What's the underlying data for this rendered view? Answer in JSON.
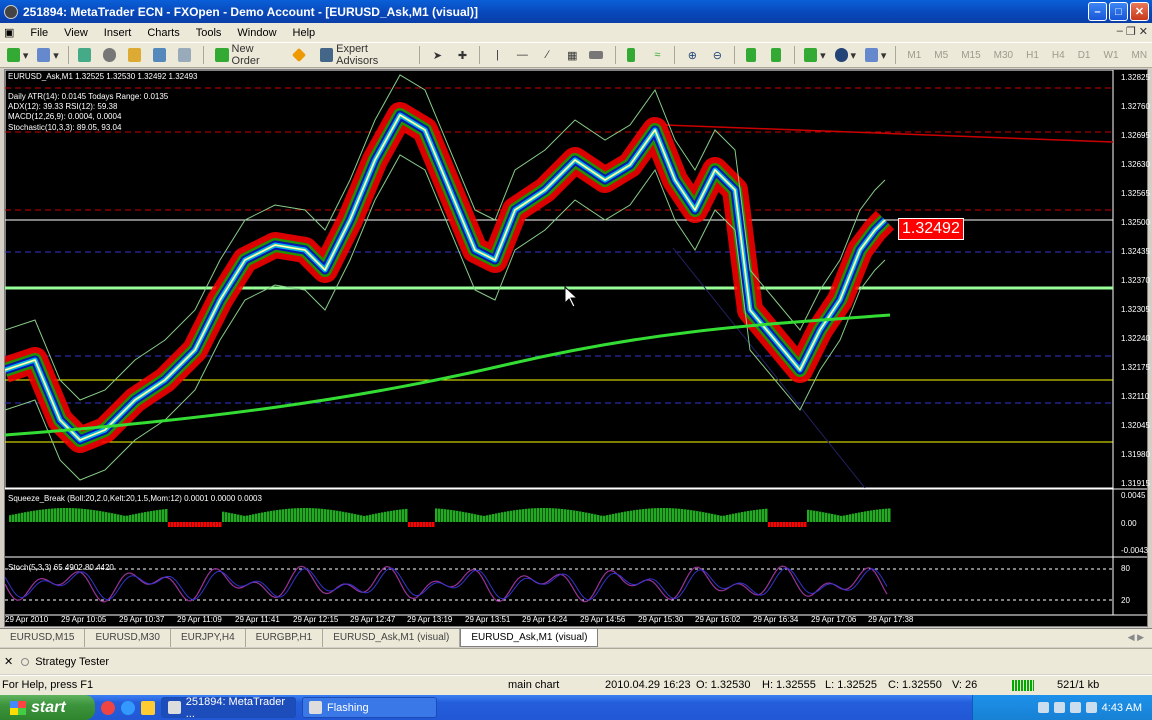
{
  "window": {
    "title": "251894: MetaTrader ECN - FXOpen - Demo Account - [EURUSD_Ask,M1 (visual)]"
  },
  "menu": [
    "File",
    "View",
    "Insert",
    "Charts",
    "Tools",
    "Window",
    "Help"
  ],
  "toolbar": {
    "new_order": "New Order",
    "expert_advisors": "Expert Advisors",
    "timeframes": [
      "M1",
      "M5",
      "M15",
      "M30",
      "H1",
      "H4",
      "D1",
      "W1",
      "MN"
    ]
  },
  "chart": {
    "header": "EURUSD_Ask,M1  1.32525 1.32530 1.32492 1.32493",
    "indicators": [
      "Daily ATR(14): 0.0145 Todays Range: 0.0135",
      "ADX(12): 39.33 RSI(12): 59.38",
      "MACD(12,26,9): 0.0004, 0.0004",
      "Stochastic(10,3,3): 89.05, 93.04"
    ],
    "current_price": "1.32492",
    "price_axis": [
      "1.32825",
      "1.32760",
      "1.32695",
      "1.32630",
      "1.32565",
      "1.32500",
      "1.32435",
      "1.32370",
      "1.32305",
      "1.32240",
      "1.32175",
      "1.32110",
      "1.32045",
      "1.31980",
      "1.31915"
    ],
    "squeeze_label": "Squeeze_Break (Boll:20,2.0,Kelt:20,1.5,Mom:12) 0.0001 0.0000 0.0003",
    "squeeze_axis": [
      "0.0045",
      "0.00",
      "-0.0043"
    ],
    "stoch_label": "Stoch(5,3,3) 65.4902 80.4420",
    "stoch_axis": [
      "80",
      "20"
    ],
    "time_axis": [
      "29 Apr 2010",
      "29 Apr 10:05",
      "29 Apr 10:37",
      "29 Apr 11:09",
      "29 Apr 11:41",
      "29 Apr 12:15",
      "29 Apr 12:47",
      "29 Apr 13:19",
      "29 Apr 13:51",
      "29 Apr 14:24",
      "29 Apr 14:56",
      "29 Apr 15:30",
      "29 Apr 16:02",
      "29 Apr 16:34",
      "29 Apr 17:06",
      "29 Apr 17:38"
    ]
  },
  "tabs": [
    "EURUSD,M15",
    "EURUSD,M30",
    "EURJPY,H4",
    "EURGBP,H1",
    "EURUSD_Ask,M1 (visual)",
    "EURUSD_Ask,M1 (visual)"
  ],
  "active_tab": 5,
  "tester": {
    "label": "Strategy Tester"
  },
  "status": {
    "help": "For Help, press F1",
    "profile": "main chart",
    "datetime": "2010.04.29 16:23",
    "open": "O: 1.32530",
    "high": "H: 1.32555",
    "low": "L: 1.32525",
    "close": "C: 1.32550",
    "volume": "V: 26",
    "traffic": "521/1 kb"
  },
  "taskbar": {
    "start": "start",
    "tasks": [
      "251894: MetaTrader ...",
      "Flashing"
    ],
    "clock": "4:43 AM"
  }
}
